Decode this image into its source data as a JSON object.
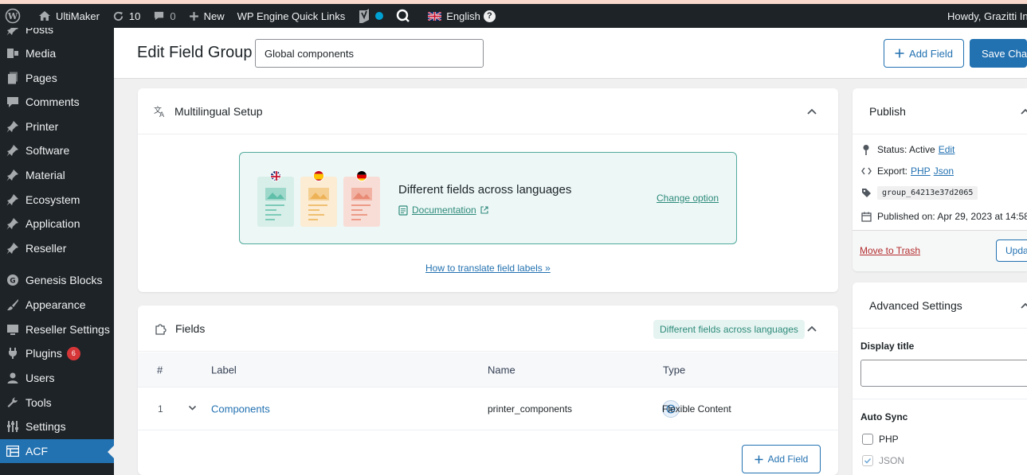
{
  "admin_bar": {
    "site_name": "UltiMaker",
    "updates_count": "10",
    "comments_count": "0",
    "new_label": "New",
    "quick_links_label": "WP Engine Quick Links",
    "language_label": "English",
    "howdy_text": "Howdy, Grazitti Inter"
  },
  "sidebar": {
    "items": [
      {
        "label": "Posts",
        "icon": "pin-icon"
      },
      {
        "label": "Media",
        "icon": "media-icon"
      },
      {
        "label": "Pages",
        "icon": "pages-icon"
      },
      {
        "label": "Comments",
        "icon": "comment-icon"
      },
      {
        "label": "Printer",
        "icon": "pin-icon"
      },
      {
        "label": "Software",
        "icon": "pin-icon"
      },
      {
        "label": "Material",
        "icon": "pin-icon"
      },
      {
        "label": "Ecosystem",
        "icon": "pin-icon"
      },
      {
        "label": "Application",
        "icon": "pin-icon"
      },
      {
        "label": "Reseller",
        "icon": "pin-icon"
      },
      {
        "label": "Genesis Blocks",
        "icon": "genesis-icon"
      },
      {
        "label": "Appearance",
        "icon": "brush-icon"
      },
      {
        "label": "Reseller Settings",
        "icon": "monitor-icon"
      },
      {
        "label": "Plugins",
        "icon": "plug-icon",
        "badge": "6"
      },
      {
        "label": "Users",
        "icon": "user-icon"
      },
      {
        "label": "Tools",
        "icon": "wrench-icon"
      },
      {
        "label": "Settings",
        "icon": "settings-icon"
      },
      {
        "label": "ACF",
        "icon": "acf-icon",
        "active": true
      }
    ]
  },
  "header": {
    "title": "Edit Field Group",
    "title_value": "Global components",
    "add_field_label": "Add Field",
    "save_label": "Save Changes"
  },
  "multilingual": {
    "title": "Multilingual Setup",
    "option_title": "Different fields across languages",
    "documentation_label": "Documentation",
    "change_option_label": "Change option",
    "translate_link": "How to translate field labels »"
  },
  "fields": {
    "title": "Fields",
    "pill_label": "Different fields across languages",
    "columns": [
      "#",
      "Label",
      "Name",
      "Type"
    ],
    "rows": [
      {
        "num": "1",
        "label": "Components",
        "name": "printer_components",
        "type": "Flexible Content"
      }
    ],
    "add_field_label": "Add Field"
  },
  "publish": {
    "title": "Publish",
    "status_label": "Status: Active",
    "status_edit": "Edit",
    "export_label": "Export:",
    "export_php": "PHP",
    "export_json": "Json",
    "group_key": "group_64213e37d2065",
    "published_on": "Published on: Apr 29, 2023 at 14:58",
    "trash_label": "Move to Trash",
    "update_label": "Update"
  },
  "advanced": {
    "title": "Advanced Settings",
    "display_title_label": "Display title",
    "display_title_value": "",
    "auto_sync_label": "Auto Sync",
    "php_label": "PHP",
    "php_checked": false,
    "json_label": "JSON",
    "json_checked": true
  },
  "colors": {
    "admin_bar": "#1d2327",
    "accent": "#2271b1",
    "teal": "#52aa9d",
    "danger": "#d63638"
  }
}
